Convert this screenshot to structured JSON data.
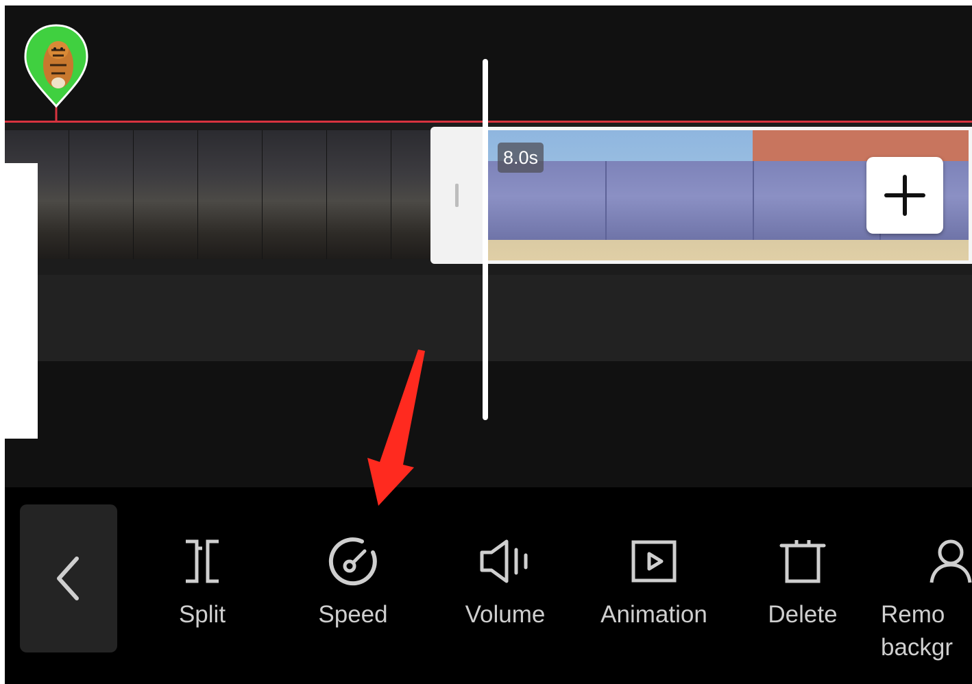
{
  "timeline": {
    "clip2_duration": "8.0s"
  },
  "toolbar": {
    "tools": [
      {
        "label": "Split",
        "icon": "split-icon"
      },
      {
        "label": "Speed",
        "icon": "speed-icon"
      },
      {
        "label": "Volume",
        "icon": "volume-icon"
      },
      {
        "label": "Animation",
        "icon": "animation-icon"
      },
      {
        "label": "Delete",
        "icon": "delete-icon"
      },
      {
        "label": "Remo\nbackgr",
        "icon": "remove-background-icon"
      }
    ]
  },
  "colors": {
    "accent_red": "#d8333f",
    "toolbar_bg": "#000000",
    "timeline_bg": "#111111",
    "label_color": "#cfcfcf"
  }
}
